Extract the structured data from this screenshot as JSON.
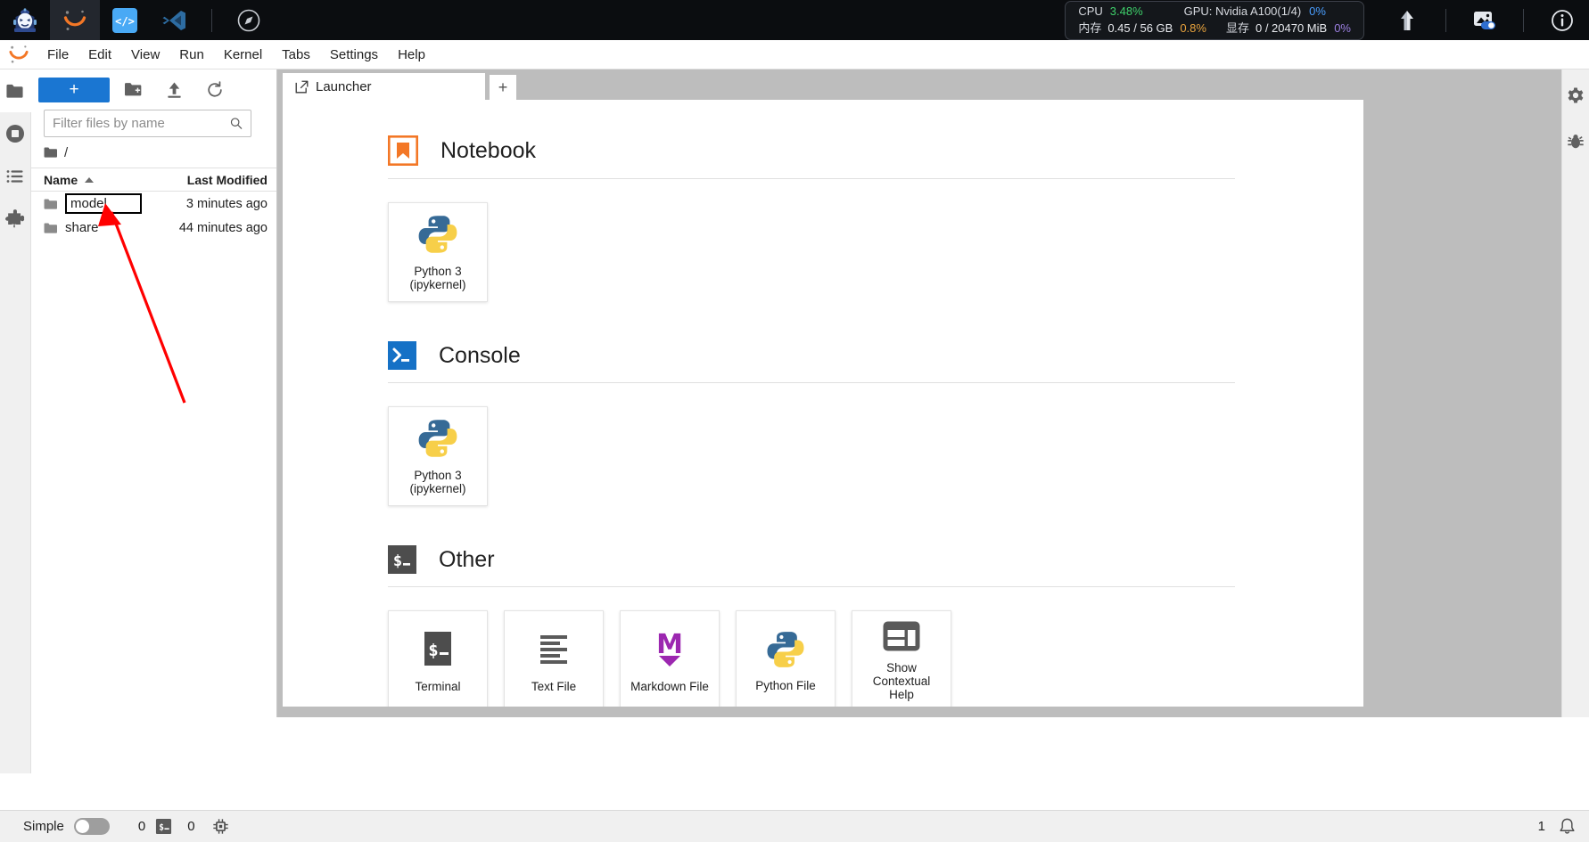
{
  "taskbar": {
    "apps": [
      {
        "name": "robot-mascot-icon",
        "label": "Robot Assistant"
      },
      {
        "name": "jupyter-icon",
        "label": "Jupyter"
      },
      {
        "name": "code-brackets-icon",
        "label": "Code Server"
      },
      {
        "name": "vscode-icon",
        "label": "VS Code"
      },
      {
        "name": "compass-icon",
        "label": "Compass"
      }
    ],
    "system": {
      "cpu_label": "CPU",
      "cpu_value": "3.48%",
      "gpu_label": "GPU: Nvidia A100(1/4)",
      "gpu_value": "0%",
      "mem_label": "内存",
      "mem_value": "0.45 / 56 GB",
      "mem_pct": "0.8%",
      "vram_label": "显存",
      "vram_value": "0 / 20470 MiB",
      "vram_pct": "0%"
    },
    "right_icons": [
      {
        "name": "upload-arrow-icon"
      },
      {
        "name": "image-toggle-icon"
      },
      {
        "name": "info-circle-icon"
      }
    ],
    "colors": {
      "background": "#0b0d10",
      "cpu_green": "#3ecf6a",
      "gpu_blue": "#4a9eff",
      "mem_orange": "#e8a33d",
      "vram_purple": "#9b7fe0"
    }
  },
  "menubar": {
    "items": [
      {
        "label": "File"
      },
      {
        "label": "Edit"
      },
      {
        "label": "View"
      },
      {
        "label": "Run"
      },
      {
        "label": "Kernel"
      },
      {
        "label": "Tabs"
      },
      {
        "label": "Settings"
      },
      {
        "label": "Help"
      }
    ]
  },
  "activitybar": {
    "items": [
      {
        "name": "file-browser-icon",
        "label": "File Browser",
        "selected": true
      },
      {
        "name": "running-sessions-icon",
        "label": "Running Terminals and Kernels",
        "selected": false
      },
      {
        "name": "commands-list-icon",
        "label": "Commands",
        "selected": false
      },
      {
        "name": "extensions-puzzle-icon",
        "label": "Extension Manager",
        "selected": false
      }
    ]
  },
  "filebrowser": {
    "toolbar": {
      "new_label": "+",
      "new_folder_icon": "new-folder-icon",
      "upload_icon": "upload-icon",
      "refresh_icon": "refresh-icon"
    },
    "filter_placeholder": "Filter files by name",
    "filter_value": "",
    "breadcrumb": "/",
    "columns": {
      "name": "Name",
      "last_modified": "Last Modified"
    },
    "sort_indicator": "ascending",
    "rows": [
      {
        "name": "model",
        "modified": "3 minutes ago",
        "type": "folder",
        "editing": true
      },
      {
        "name": "share",
        "modified": "44 minutes ago",
        "type": "folder",
        "editing": false
      }
    ]
  },
  "dock": {
    "tabs": [
      {
        "label": "Launcher",
        "icon": "launcher-icon",
        "active": true
      }
    ],
    "add_tab_label": "+"
  },
  "launcher": {
    "sections": [
      {
        "title": "Notebook",
        "icon": "notebook-bookmark-icon",
        "cards": [
          {
            "label": "Python 3\n(ipykernel)",
            "line1": "Python 3",
            "line2": "(ipykernel)",
            "icon": "python-logo-icon"
          }
        ]
      },
      {
        "title": "Console",
        "icon": "console-prompt-icon",
        "cards": [
          {
            "label": "Python 3\n(ipykernel)",
            "line1": "Python 3",
            "line2": "(ipykernel)",
            "icon": "python-logo-icon"
          }
        ]
      },
      {
        "title": "Other",
        "icon": "other-shell-icon",
        "cards": [
          {
            "line1": "Terminal",
            "line2": "",
            "icon": "terminal-icon"
          },
          {
            "line1": "Text File",
            "line2": "",
            "icon": "text-file-icon"
          },
          {
            "line1": "Markdown File",
            "line2": "",
            "icon": "markdown-icon"
          },
          {
            "line1": "Python File",
            "line2": "",
            "icon": "python-logo-icon"
          },
          {
            "line1": "Show",
            "line2": "Contextual",
            "line3": "Help",
            "icon": "contextual-help-icon"
          }
        ]
      }
    ]
  },
  "rightbar": {
    "items": [
      {
        "name": "property-inspector-icon"
      },
      {
        "name": "debugger-icon"
      }
    ]
  },
  "statusbar": {
    "simple_label": "Simple",
    "simple_on": false,
    "kernel_count": "0",
    "terminal_count": "0",
    "terminal_icon": "terminal-small-icon",
    "kernel_icon": "kernel-chip-icon",
    "notification_count": "1",
    "notification_icon": "bell-icon"
  },
  "annotation": {
    "arrow_color": "#ff0000",
    "target": "model"
  }
}
